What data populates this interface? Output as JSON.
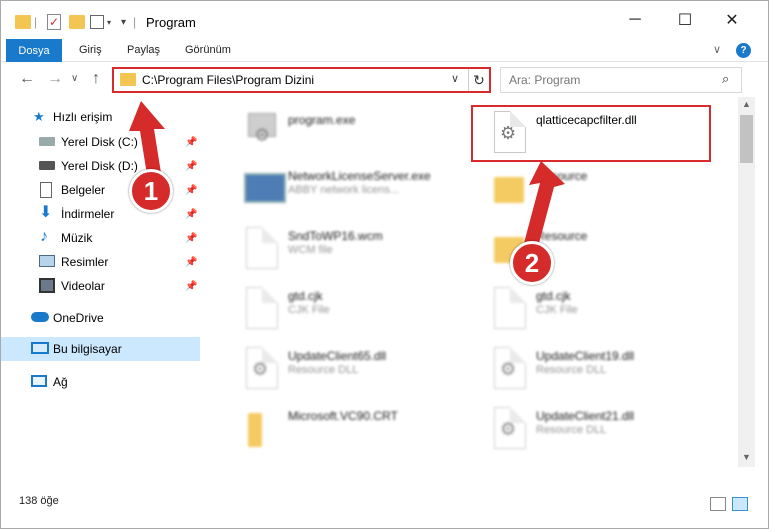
{
  "window": {
    "title": "Program",
    "minimize_symbol": "─",
    "maximize_symbol": "☐",
    "close_symbol": "✕"
  },
  "ribbon": {
    "file_tab": "Dosya",
    "tabs": [
      "Giriş",
      "Paylaş",
      "Görünüm"
    ],
    "help_symbol": "?",
    "collapse_symbol": "∨"
  },
  "navigation": {
    "back_symbol": "←",
    "forward_symbol": "→",
    "recent_symbol": "∨",
    "up_symbol": "↑",
    "address_path": "C:\\Program Files\\Program Dizini",
    "address_dropdown_symbol": "∨",
    "refresh_symbol": "↻",
    "search_placeholder": "Ara: Program",
    "search_symbol": "⌕"
  },
  "sidebar": {
    "quick_access": "Hızlı erişim",
    "items": [
      {
        "label": "Yerel Disk (C:)",
        "icon": "drive-icon",
        "pinned": true
      },
      {
        "label": "Yerel Disk (D:)",
        "icon": "drive-icon",
        "pinned": true
      },
      {
        "label": "Belgeler",
        "icon": "documents-icon",
        "pinned": true
      },
      {
        "label": "İndirmeler",
        "icon": "downloads-icon",
        "pinned": true
      },
      {
        "label": "Müzik",
        "icon": "music-icon",
        "pinned": true
      },
      {
        "label": "Resimler",
        "icon": "pictures-icon",
        "pinned": true
      },
      {
        "label": "Videolar",
        "icon": "videos-icon",
        "pinned": true
      }
    ],
    "onedrive": "OneDrive",
    "this_pc": "Bu bilgisayar",
    "network": "Ağ",
    "pin_symbol": "📌"
  },
  "files": {
    "highlighted": {
      "name": "qlatticecapcfilter.dll",
      "description": ""
    },
    "items": [
      {
        "name": "program.exe",
        "description": ""
      },
      {
        "name": "NetworkLicenseServer.exe",
        "description": "ABBY network licens..."
      },
      {
        "name": "Resource",
        "description": ""
      },
      {
        "name": "SndToWP16.wcm",
        "description": "WCM file"
      },
      {
        "name": "Resource",
        "description": ""
      },
      {
        "name": "gtd.cjk",
        "description": "CJK File"
      },
      {
        "name": "gtd.cjk",
        "description": "CJK File"
      },
      {
        "name": "UpdateClient65.dll",
        "description": "Resource DLL"
      },
      {
        "name": "UpdateClient19.dll",
        "description": "Resource DLL"
      },
      {
        "name": "Microsoft.VC90.CRT",
        "description": ""
      },
      {
        "name": "UpdateClient21.dll",
        "description": "Resource DLL"
      }
    ]
  },
  "status": {
    "item_count": "138 öğe"
  },
  "annotations": {
    "badge_1": "1",
    "badge_2": "2",
    "color": "#d62b2b"
  },
  "colors": {
    "accent": "#1979ca",
    "selection": "#cce8ff",
    "highlight_border": "#d92b2b",
    "folder": "#f3c653"
  }
}
